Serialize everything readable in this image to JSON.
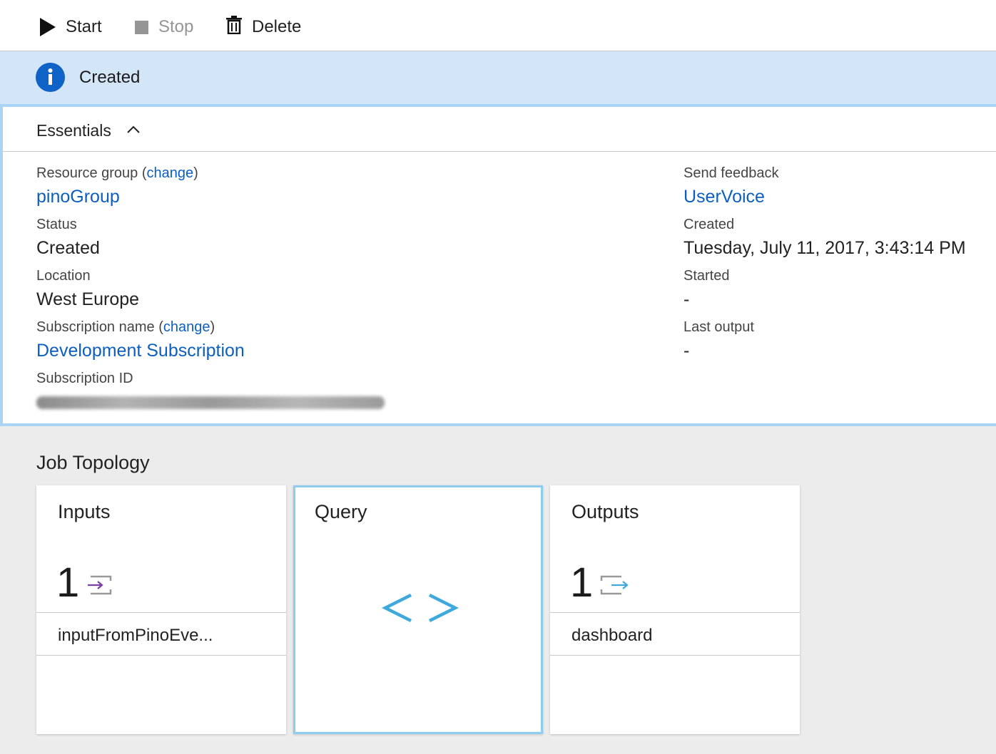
{
  "toolbar": {
    "start_label": "Start",
    "stop_label": "Stop",
    "delete_label": "Delete"
  },
  "notification": {
    "icon": "info-icon",
    "text": "Created"
  },
  "essentials": {
    "title": "Essentials",
    "left": {
      "resource_group_label": "Resource group",
      "resource_group_change": "change",
      "resource_group_value": "pinoGroup",
      "status_label": "Status",
      "status_value": "Created",
      "location_label": "Location",
      "location_value": "West Europe",
      "subscription_name_label": "Subscription name",
      "subscription_name_change": "change",
      "subscription_name_value": "Development Subscription",
      "subscription_id_label": "Subscription ID"
    },
    "right": {
      "send_feedback_label": "Send feedback",
      "send_feedback_value": "UserVoice",
      "created_label": "Created",
      "created_value": "Tuesday, July 11, 2017, 3:43:14 PM",
      "started_label": "Started",
      "started_value": "-",
      "last_output_label": "Last output",
      "last_output_value": "-"
    }
  },
  "job_topology": {
    "title": "Job Topology",
    "inputs": {
      "title": "Inputs",
      "count": "1",
      "icon": "input-icon",
      "item": "inputFromPinoEve..."
    },
    "query": {
      "title": "Query",
      "icon": "code-brackets-icon"
    },
    "outputs": {
      "title": "Outputs",
      "count": "1",
      "icon": "output-icon",
      "item": "dashboard"
    }
  },
  "colors": {
    "accent": "#0c5fbf",
    "info_bar": "#d3e6f8",
    "info_icon": "#0f62c6",
    "selected_border": "#8fcdf0",
    "query_glyph": "#3fa8dc",
    "input_arrow": "#7b3fa6",
    "output_arrow": "#3fa8dc"
  }
}
